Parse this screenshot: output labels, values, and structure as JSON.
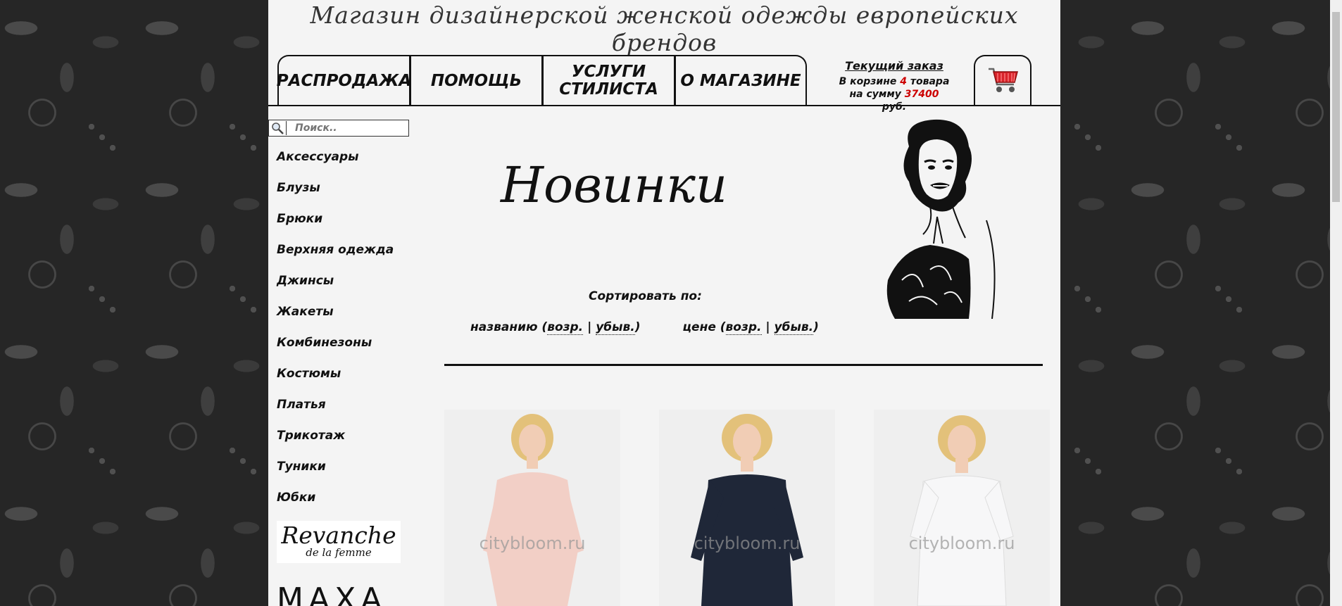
{
  "header": {
    "site_title": "Магазин дизайнерской женской одежды европейских брендов"
  },
  "nav": {
    "items": [
      {
        "label": "РАСПРОДАЖА"
      },
      {
        "label": "ПОМОЩЬ"
      },
      {
        "label": "УСЛУГИ СТИЛИСТА"
      },
      {
        "label": "О МАГАЗИНЕ"
      }
    ]
  },
  "order": {
    "title": "Текущий заказ",
    "in_cart_prefix": "В корзине",
    "count": "4",
    "count_suffix": "товара",
    "sum_prefix": "на сумму",
    "sum": "37400",
    "currency": "руб."
  },
  "search": {
    "placeholder": "Поиск.."
  },
  "sidebar": {
    "categories": [
      "Аксессуары",
      "Блузы",
      "Брюки",
      "Верхняя одежда",
      "Джинсы",
      "Жакеты",
      "Комбинезоны",
      "Костюмы",
      "Платья",
      "Трикотаж",
      "Туники",
      "Юбки"
    ],
    "brand1_main": "Revanche",
    "brand1_sub": "de la femme",
    "brand2": "MAXA"
  },
  "main": {
    "heading": "Новинки",
    "sort_label": "Сортировать по:",
    "sort_name": "названию (",
    "sort_price": "цене (",
    "asc": "возр.",
    "desc": "убыв.",
    "sep": " | ",
    "close": ")"
  },
  "products": [
    {
      "watermark": "citybloom.ru",
      "garment_color": "#f2cfc6"
    },
    {
      "watermark": "citybloom.ru",
      "garment_color": "#1f2738"
    },
    {
      "watermark": "citybloom.ru",
      "garment_color": "#f7f7f8"
    }
  ],
  "colors": {
    "accent_red": "#cc0000",
    "text": "#111111",
    "page_bg": "#f4f4f4"
  }
}
